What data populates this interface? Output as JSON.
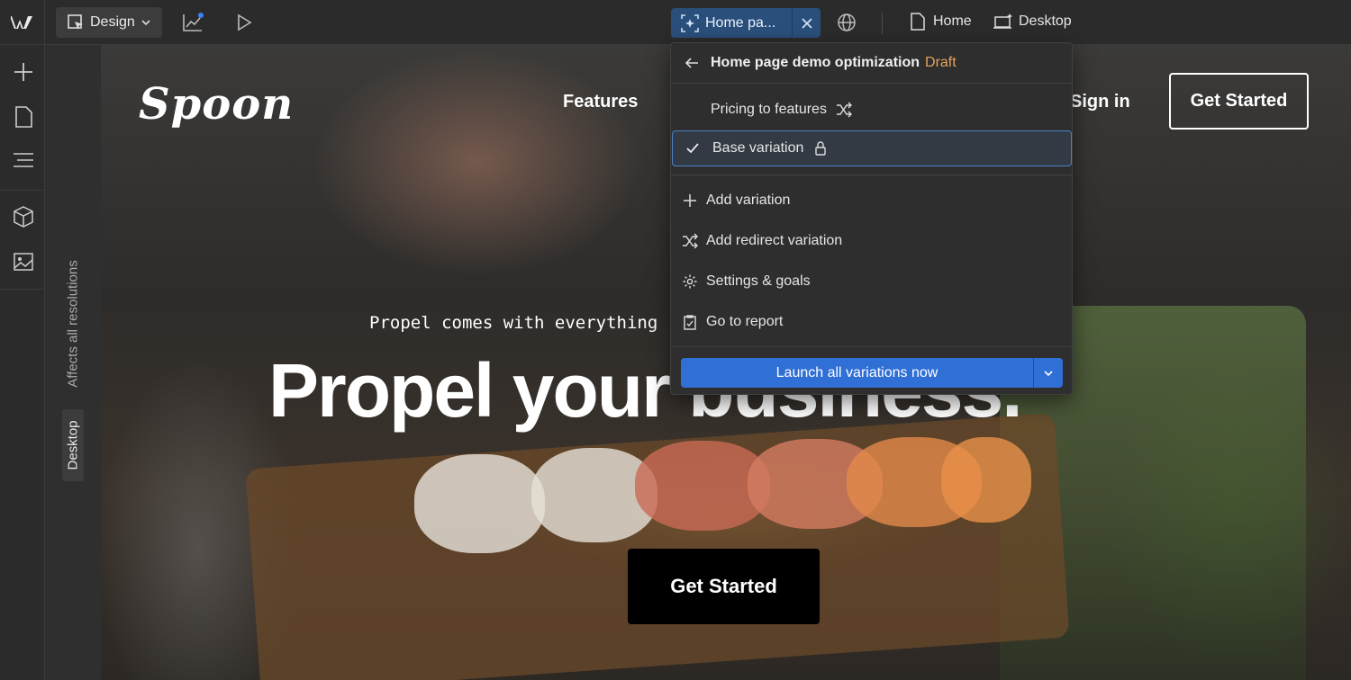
{
  "toolbar": {
    "mode_label": "Design",
    "variant_label": "Home pa...",
    "page_label": "Home",
    "breakpoint_label": "Desktop"
  },
  "sidebar": {
    "resolution_tab": "Desktop",
    "affects_label": "Affects all resolutions"
  },
  "site": {
    "logo_text": "Spoon",
    "nav_features": "Features",
    "nav_signin": "Sign in",
    "nav_cta": "Get Started",
    "subheading": "Propel comes with everything",
    "headline": "Propel your business.",
    "hero_cta": "Get Started"
  },
  "menu": {
    "title": "Home page demo optimization",
    "status": "Draft",
    "variations": [
      {
        "label": "Pricing to features",
        "icon": "shuffle-icon",
        "selected": false
      },
      {
        "label": "Base variation",
        "icon": "lock-icon",
        "selected": true
      }
    ],
    "actions": [
      {
        "label": "Add variation",
        "icon": "plus-icon"
      },
      {
        "label": "Add redirect variation",
        "icon": "shuffle-icon"
      },
      {
        "label": "Settings & goals",
        "icon": "gear-icon"
      },
      {
        "label": "Go to report",
        "icon": "report-icon"
      }
    ],
    "launch_label": "Launch all variations now"
  },
  "colors": {
    "accent": "#2f6fd6",
    "draft": "#e8a25a",
    "variant_chip": "#2a4f7a"
  }
}
